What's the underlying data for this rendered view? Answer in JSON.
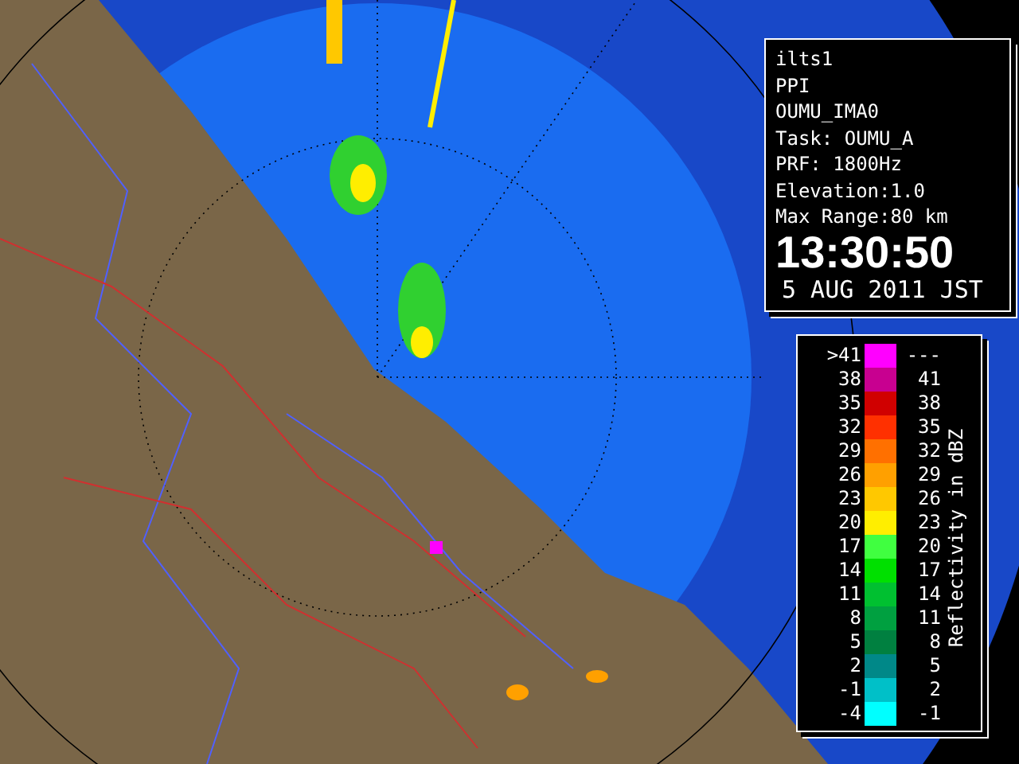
{
  "info": {
    "lines": [
      "ilts1",
      "PPI",
      "OUMU_IMA0",
      "Task: OUMU_A",
      "PRF: 1800Hz",
      "Elevation:1.0",
      "Max Range:80 km"
    ],
    "time": "13:30:50",
    "date": "5 AUG 2011 JST"
  },
  "legend": {
    "title": "Reflectivity in dBZ",
    "rows": [
      {
        "low": ">41",
        "high": "---",
        "color": "#ff00ff"
      },
      {
        "low": "38",
        "high": "41",
        "color": "#c80090"
      },
      {
        "low": "35",
        "high": "38",
        "color": "#d00000"
      },
      {
        "low": "32",
        "high": "35",
        "color": "#ff3000"
      },
      {
        "low": "29",
        "high": "32",
        "color": "#ff7000"
      },
      {
        "low": "26",
        "high": "29",
        "color": "#ffa000"
      },
      {
        "low": "23",
        "high": "26",
        "color": "#ffc800"
      },
      {
        "low": "20",
        "high": "23",
        "color": "#ffee00"
      },
      {
        "low": "17",
        "high": "20",
        "color": "#40ff40"
      },
      {
        "low": "14",
        "high": "17",
        "color": "#00e000"
      },
      {
        "low": "11",
        "high": "14",
        "color": "#00c030"
      },
      {
        "low": "8",
        "high": "11",
        "color": "#00a040"
      },
      {
        "low": "5",
        "high": "8",
        "color": "#008040"
      },
      {
        "low": "2",
        "high": "5",
        "color": "#008888"
      },
      {
        "low": "-1",
        "high": "2",
        "color": "#00c0c8"
      },
      {
        "low": "-4",
        "high": "-1",
        "color": "#00ffff"
      }
    ]
  }
}
